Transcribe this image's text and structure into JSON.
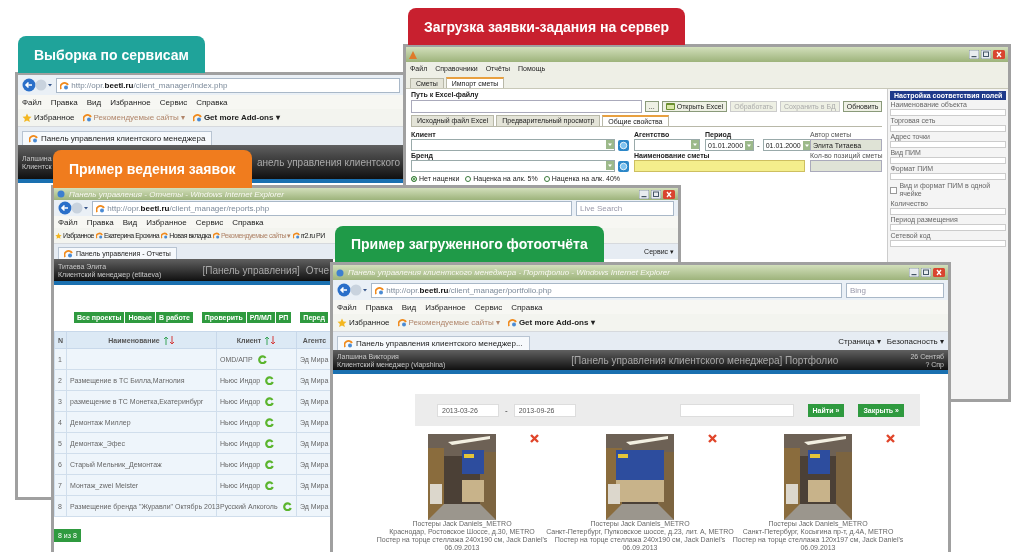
{
  "callouts": [
    {
      "text": "Выборка по сервисам",
      "color": "#1fa39a"
    },
    {
      "text": "Загрузка заявки-задания на сервер",
      "color": "#c8202f"
    },
    {
      "text": "Пример ведения заявок",
      "color": "#f07c1e"
    },
    {
      "text": "Пример загруженного фотоотчёта",
      "color": "#1f9a48"
    }
  ],
  "services_window": {
    "address": "http://opr.**beetl.ru**/client_manager/index.php",
    "menu": [
      "Файл",
      "Правка",
      "Вид",
      "Избранное",
      "Сервис",
      "Справка"
    ],
    "favorites": [
      {
        "kind": "favorites",
        "label": "Избранное",
        "disabled": false
      },
      {
        "kind": "link",
        "label": "Рекомендуемые сайты ▾",
        "disabled": true
      },
      {
        "kind": "addon",
        "label": "Get more Add-ons ▾",
        "disabled": false
      }
    ],
    "tab": "Панель управления клиентского менеджера",
    "header": {
      "user": "Лапшина",
      "role": "Клиентск",
      "title": "анель управления клиентского"
    }
  },
  "import_window": {
    "menu": [
      "Файл",
      "Справочники",
      "Отчёты",
      "Помощь"
    ],
    "tabs": [
      {
        "label": "Сметы",
        "selected": false
      },
      {
        "label": "Импорт сметы",
        "selected": true
      }
    ],
    "path_label": "Путь к Excel-файлу",
    "buttons": [
      {
        "label": "...",
        "disabled": false
      },
      {
        "label": "Открыть Excel",
        "disabled": false
      },
      {
        "label": "Обработать",
        "disabled": true
      },
      {
        "label": "Сохранить в БД",
        "disabled": true
      },
      {
        "label": "Обновить",
        "disabled": false
      }
    ],
    "subtabs": [
      {
        "label": "Исходный файл Excel",
        "selected": false
      },
      {
        "label": "Предварительный просмотр",
        "selected": false
      },
      {
        "label": "Общие свойства",
        "selected": true
      }
    ],
    "form": {
      "client_label": "Клиент",
      "agency_label": "Агентство",
      "period_label": "Период",
      "period_from": "01.01.2000",
      "period_dash": "-",
      "period_to": "01.01.2000",
      "author_label": "Автор сметы",
      "author": "Элита Титаева",
      "brand_label": "Бренд",
      "estimate_name_label": "Наименование сметы",
      "positions_label": "Кол-во позиций сметы"
    },
    "radios": [
      {
        "label": "Нет наценки",
        "selected": true
      },
      {
        "label": "Наценка на алк. 5%",
        "selected": false
      },
      {
        "label": "Наценка на алк. 40%",
        "selected": false
      }
    ],
    "mapping_panel": {
      "title": "Настройка соответствия полей",
      "items": [
        {
          "kind": "field",
          "label": "Наименование объекта"
        },
        {
          "kind": "field",
          "label": "Торговая сеть"
        },
        {
          "kind": "field",
          "label": "Адрес точки"
        },
        {
          "kind": "field",
          "label": "Вид ПИМ"
        },
        {
          "kind": "field",
          "label": "Формат ПИМ"
        },
        {
          "kind": "checkbox",
          "label": "Вид и формат ПИМ в одной ячейке",
          "checked": false
        },
        {
          "kind": "field",
          "label": "Количество"
        },
        {
          "kind": "field",
          "label": "Период размещения"
        },
        {
          "kind": "field",
          "label": "Сетевой код"
        }
      ]
    }
  },
  "reports_window": {
    "title": "Панель управления - Отчеты - Windows Internet Explorer",
    "address": "http://opr.**beetl.ru**/client_manager/reports.php",
    "search": {
      "placeholder": "Live Search"
    },
    "menu": [
      "Файл",
      "Правка",
      "Вид",
      "Избранное",
      "Сервис",
      "Справка"
    ],
    "favorites": [
      {
        "kind": "favorites",
        "label": "Избранное",
        "disabled": false
      },
      {
        "kind": "link",
        "label": "Екатерина Ерохина",
        "disabled": false
      },
      {
        "kind": "link",
        "label": "Новая вкладка",
        "disabled": false
      },
      {
        "kind": "link",
        "label": "Рекомендуемые сайты ▾",
        "disabled": true
      },
      {
        "kind": "link",
        "label": "rr2.ru РИ",
        "disabled": false
      }
    ],
    "tab": "Панель управления - Отчеты",
    "commands": [
      "Сервис ▾"
    ],
    "header": {
      "user": "Титаева Элита",
      "role": "Клиентский менеджер (etitaeva)",
      "nav": "[Панель управления]",
      "section": "Отче"
    },
    "filter_groups": [
      [
        "Все проекты",
        "Новые",
        "В работе"
      ],
      [
        "Проверить",
        "РЛ/МЛ",
        "РП"
      ],
      [
        "Перед"
      ]
    ],
    "columns": [
      {
        "label": "N",
        "sortable": false
      },
      {
        "label": "Наименование",
        "sortable": true
      },
      {
        "label": "Клиент",
        "sortable": true
      },
      {
        "label": "Агентс",
        "sortable": false
      }
    ],
    "rows": [
      {
        "n": "1",
        "client": "OMD/АПР",
        "agency": "Эд Мира"
      },
      {
        "n": "2",
        "name": "Размещение в ТС Билла,Магнолия",
        "client": "Ньюс Индор",
        "agency": "Эд Мира"
      },
      {
        "n": "3",
        "name": "размещение в ТС Монетка,Екатеринбург",
        "client": "Ньюс Индор",
        "agency": "Эд Мира"
      },
      {
        "n": "4",
        "name": "Демонтаж Миллер",
        "client": "Ньюс Индор",
        "agency": "Эд Мира"
      },
      {
        "n": "5",
        "name": "Демонтаж_Эфес",
        "client": "Ньюс Индор",
        "agency": "Эд Мира"
      },
      {
        "n": "6",
        "name": "Старый Мельник_Демонтаж",
        "client": "Ньюс Индор",
        "agency": "Эд Мира"
      },
      {
        "n": "7",
        "name": "Монтаж_zwei Meister",
        "client": "Ньюс Индор",
        "agency": "Эд Мира"
      },
      {
        "n": "8",
        "name": "Размещение бренда \"Журавли\" Октябрь 2013",
        "client": "Русский Алкоголь",
        "agency": "Эд Мира"
      }
    ],
    "footer": "8 из 8"
  },
  "portfolio_window": {
    "title": "Панель управления клиентского менеджера - Портфолио - Windows Internet Explorer",
    "address": "http://opr.**beetl.ru**/client_manager/portfolio.php",
    "search": {
      "placeholder": "Bing"
    },
    "menu": [
      "Файл",
      "Правка",
      "Вид",
      "Избранное",
      "Сервис",
      "Справка"
    ],
    "favorites": [
      {
        "kind": "favorites",
        "label": "Избранное",
        "disabled": false
      },
      {
        "kind": "link",
        "label": "Рекомендуемые сайты ▾",
        "disabled": true
      },
      {
        "kind": "addon",
        "label": "Get more Add-ons ▾",
        "disabled": false
      }
    ],
    "tab": "Панель управления клиентского менеджер...",
    "commands": [
      "Страница ▾",
      "Безопасность ▾"
    ],
    "header": {
      "user": "Лапшина Виктория",
      "role": "Клиентский менеджер (vlapshina)",
      "title": "[Панель управления клиентского менеджера]  Портфолио",
      "date": "26 Сентяб",
      "help": "? Спр"
    },
    "filter": {
      "from": "2013-03-26",
      "dash": "-",
      "to": "2013-09-26",
      "buttons": [
        "Найти »",
        "Закрыть »"
      ]
    },
    "photos": [
      {
        "kind": "picture",
        "lines": [
          "Постеры Jack Daniels_METRO",
          "Краснодар, Ростовское Шоссе, д.30, METRO",
          "Постер на торце стеллажа 240x190 см, Jack Daniel's",
          "06.09.2013"
        ]
      },
      {
        "kind": "picture",
        "lines": [
          "Постеры Jack Daniels_METRO",
          "Санкт-Петербург, Пулковское шоссе, д.23, лит. А, METRO",
          "Постер на торце стеллажа 240x190 см, Jack Daniel's",
          "06.09.2013"
        ]
      },
      {
        "kind": "picture",
        "lines": [
          "Постеры Jack Daniels_METRO",
          "Санкт-Петербург, Косыгина пр-т, д.4А, METRO",
          "Постер на торце стеллажа 120x197 см, Jack Daniel's",
          "06.09.2013"
        ]
      }
    ]
  }
}
